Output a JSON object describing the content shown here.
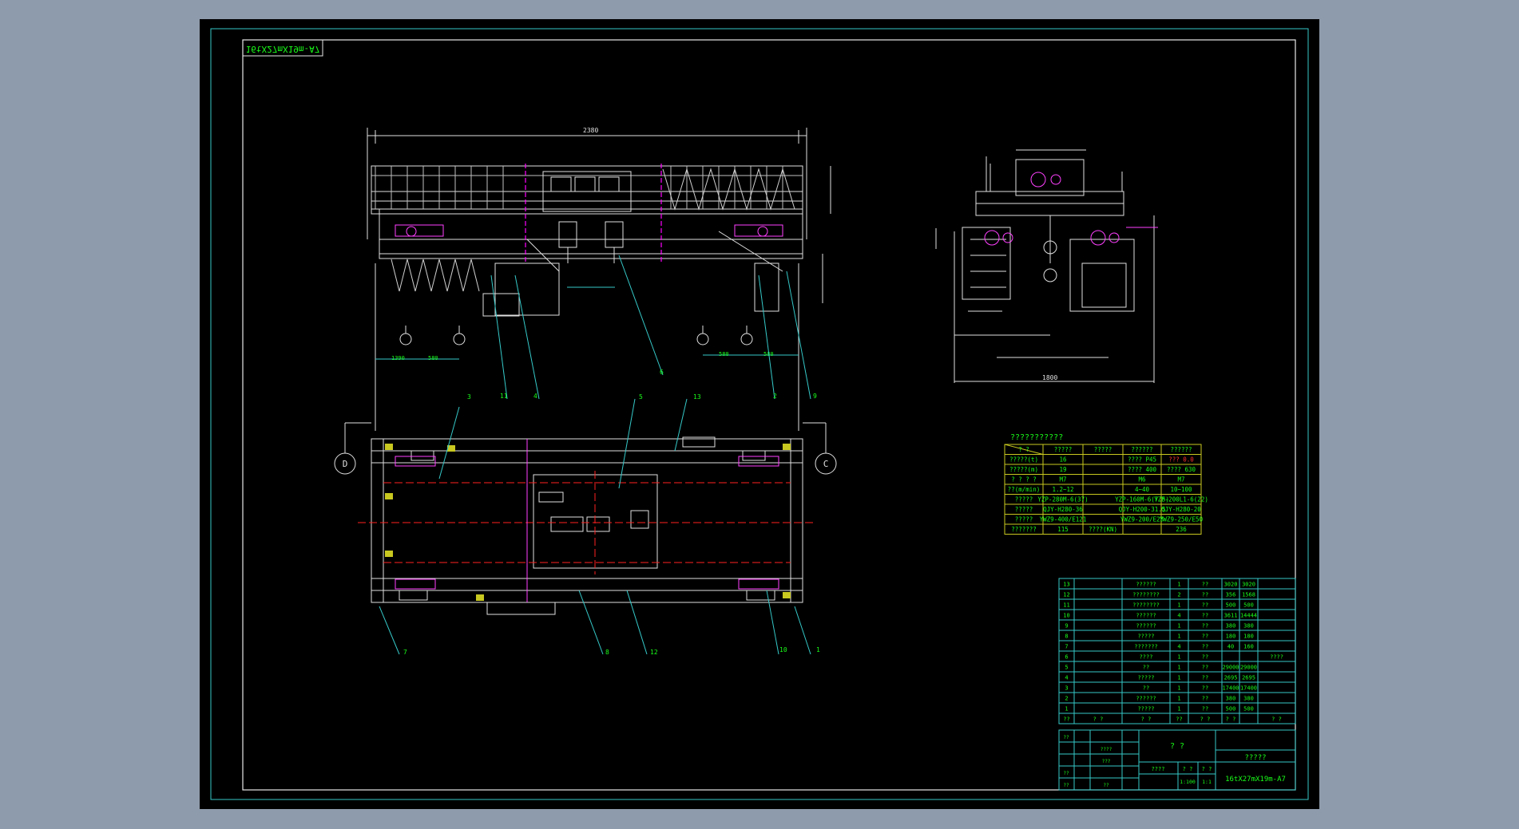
{
  "drawing": {
    "stamp_mirrored": "16tX27mX19m-A7",
    "title_code": "16tX27mX19m-A7",
    "main_width_dim": "2380",
    "trolley_width_dim": "1800",
    "left_dims": [
      "1390",
      "580"
    ],
    "right_dims": [
      "580",
      "580"
    ],
    "axis_left": "D",
    "axis_right": "C",
    "balloons": [
      "11",
      "4",
      "6",
      "2",
      "9",
      "3",
      "5",
      "13",
      "7",
      "8",
      "12",
      "10",
      "1"
    ]
  },
  "params": {
    "title": "???????????",
    "headers": [
      "? ?",
      "?????",
      "?????",
      "??????",
      "??????"
    ],
    "rows": [
      [
        "?????(t)",
        "16",
        "",
        "????  P45",
        "???  0.0"
      ],
      [
        "?????(m)",
        "19",
        "",
        "????  400",
        "????  630"
      ],
      [
        "? ? ? ?",
        "M7",
        "",
        "M6",
        "M7"
      ],
      [
        "??(m/min)",
        "1.2~12",
        "",
        "4~40",
        "10~100"
      ],
      [
        "?????",
        "YZP-280M-6(37)",
        "",
        "YZP-160M-6(7.5)",
        "YZP-200L1-6(22)"
      ],
      [
        "?????",
        "QJY-H280-36",
        "",
        "QJY-H200-31.5",
        "QJY-H280-20"
      ],
      [
        "?????",
        "YWZ9-400/E121",
        "",
        "YWZ9-200/E23",
        "YWZ9-250/E50"
      ],
      [
        "???????",
        "115",
        "????(KN)",
        "",
        "236"
      ]
    ]
  },
  "bom": {
    "rows": [
      [
        "13",
        "",
        "??????",
        "1",
        "??",
        "3020",
        "3020",
        ""
      ],
      [
        "12",
        "",
        "????????",
        "2",
        "??",
        "356",
        "1568",
        ""
      ],
      [
        "11",
        "",
        "????????",
        "1",
        "??",
        "500",
        "500",
        ""
      ],
      [
        "10",
        "",
        "??????",
        "4",
        "??",
        "3611",
        "14444",
        ""
      ],
      [
        "9",
        "",
        "??????",
        "1",
        "??",
        "380",
        "380",
        ""
      ],
      [
        "8",
        "",
        "?????",
        "1",
        "??",
        "180",
        "180",
        ""
      ],
      [
        "7",
        "",
        "???????",
        "4",
        "??",
        "40",
        "160",
        ""
      ],
      [
        "6",
        "",
        "????",
        "1",
        "??",
        "",
        "",
        "????"
      ],
      [
        "5",
        "",
        "??",
        "1",
        "??",
        "29000",
        "29000",
        ""
      ],
      [
        "4",
        "",
        "?????",
        "1",
        "??",
        "2695",
        "2695",
        ""
      ],
      [
        "3",
        "",
        "??",
        "1",
        "??",
        "17400",
        "17400",
        ""
      ],
      [
        "2",
        "",
        "??????",
        "1",
        "??",
        "380",
        "380",
        ""
      ],
      [
        "1",
        "",
        "?????",
        "1",
        "??",
        "500",
        "500",
        ""
      ]
    ],
    "header": [
      "??",
      "? ?",
      "? ?",
      "??",
      "? ?",
      "? ?",
      "",
      "? ?"
    ]
  },
  "titleblock": {
    "name": "? ?",
    "company": "?????",
    "row_a": [
      "????",
      "? ?",
      "? ?"
    ],
    "scale": "1:100",
    "sheet": "1:1",
    "labels": [
      "??",
      "????",
      "???",
      "??",
      "??",
      "??"
    ]
  }
}
